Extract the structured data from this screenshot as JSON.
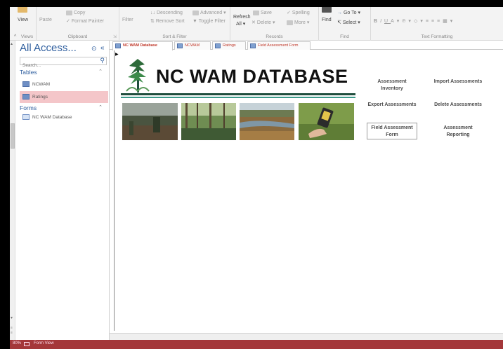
{
  "ribbon": {
    "views": {
      "view_label": "View",
      "caption": "Views"
    },
    "clipboard": {
      "paste_label": "Paste",
      "copy_label": "Copy",
      "format_painter_label": "Format Painter",
      "caption": "Clipboard"
    },
    "sort_filter": {
      "filter_label": "Filter",
      "descending_label": "Descending",
      "advanced_label": "Advanced",
      "remove_sort_label": "Remove Sort",
      "toggle_filter_label": "Toggle Filter",
      "caption": "Sort & Filter"
    },
    "records": {
      "refresh_label": "Refresh",
      "refresh_all_label": "All",
      "save_label": "Save",
      "delete_label": "Delete",
      "spelling_label": "Spelling",
      "more_label": "More",
      "caption": "Records"
    },
    "find": {
      "find_label": "Find",
      "goto_label": "Go To",
      "select_label": "Select",
      "caption": "Find"
    },
    "text_formatting": {
      "caption": "Text Formatting"
    }
  },
  "nav": {
    "title": "All Access...",
    "search_placeholder": "Search...",
    "sections": [
      {
        "label": "Tables",
        "items": [
          {
            "label": "NCWAM"
          },
          {
            "label": "Ratings"
          }
        ]
      },
      {
        "label": "Forms",
        "items": [
          {
            "label": "NC WAM Database"
          }
        ]
      }
    ]
  },
  "tabs": [
    {
      "label": "NC WAM Database",
      "active": true
    },
    {
      "label": "NCWAM",
      "active": false
    },
    {
      "label": "Ratings",
      "active": false
    },
    {
      "label": "Field Assessment Form",
      "active": false
    }
  ],
  "banner": {
    "title": "NC WAM DATABASE"
  },
  "switchboard": {
    "assessment_inventory": "Assessment Inventory",
    "import_assessments": "Import Assessments",
    "export_assessments": "Export Assessments",
    "delete_assessments": "Delete Assessments",
    "field_assessment_form": "Field Assessment Form",
    "assessment_reporting": "Assessment Reporting"
  },
  "status": {
    "left": "80%",
    "view": "Form View"
  },
  "colors": {
    "accent": "#2e5e9e",
    "status_bar": "#a4373a",
    "tab_text": "#c0392b",
    "selected_item": "#f4c6c9",
    "title_rule": "#1f4e3d"
  }
}
